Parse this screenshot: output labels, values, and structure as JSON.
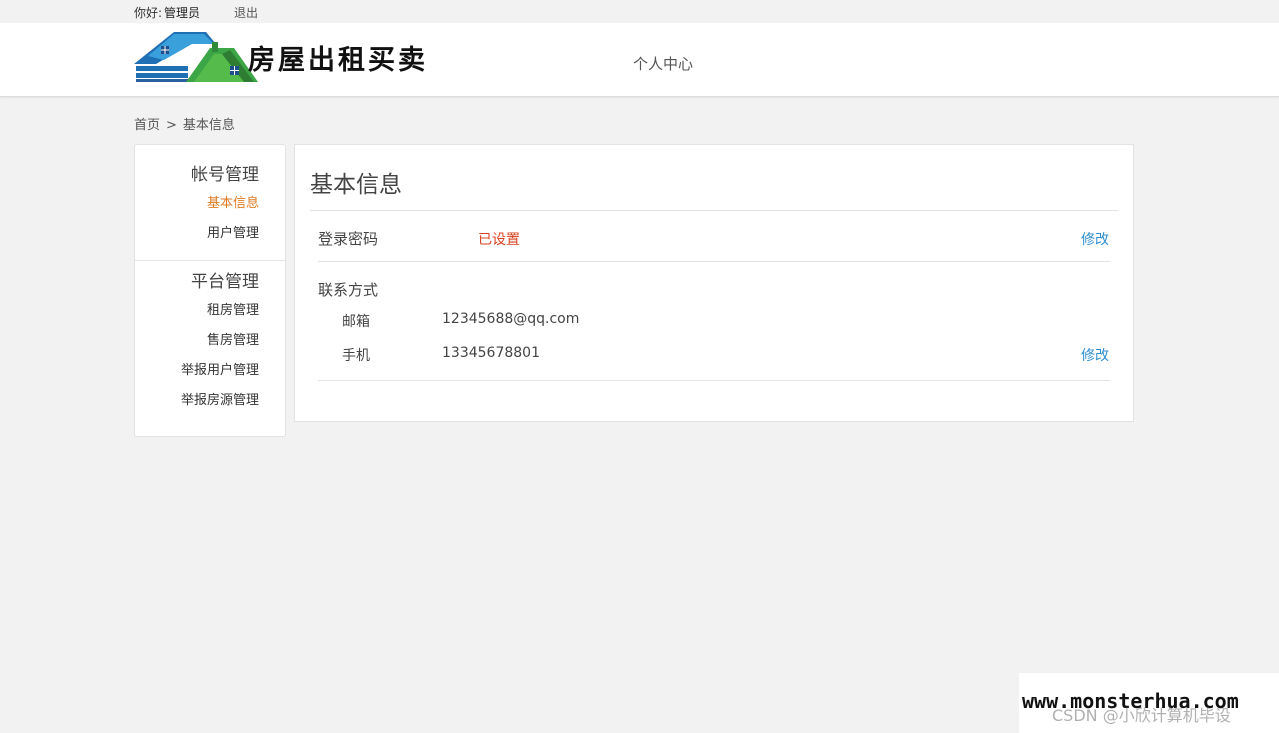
{
  "topbar": {
    "greeting": "你好:",
    "username": "管理员",
    "logout": "退出"
  },
  "header": {
    "logo_text": "房屋出租买卖",
    "nav": [
      "个人中心"
    ]
  },
  "breadcrumb": {
    "home": "首页",
    "separator": ">",
    "current": "基本信息"
  },
  "sidebar": {
    "sections": [
      {
        "title": "帐号管理",
        "items": [
          "基本信息",
          "用户管理"
        ],
        "active": "基本信息"
      },
      {
        "title": "平台管理",
        "items": [
          "租房管理",
          "售房管理",
          "举报用户管理",
          "举报房源管理"
        ]
      }
    ]
  },
  "content": {
    "title": "基本信息",
    "password_label": "登录密码",
    "password_status": "已设置",
    "edit_label": "修改",
    "contact_label": "联系方式",
    "email_label": "邮箱",
    "email_value": "12345688@qq.com",
    "phone_label": "手机",
    "phone_value": "13345678801"
  },
  "watermark": {
    "site": "www.monsterhua.com",
    "csdn": "CSDN @小欣计算机毕设"
  },
  "colors": {
    "accent_orange": "#e07b24",
    "link_blue": "#2f8fd0",
    "status_red": "#d9411e",
    "background": "#f2f2f2"
  }
}
